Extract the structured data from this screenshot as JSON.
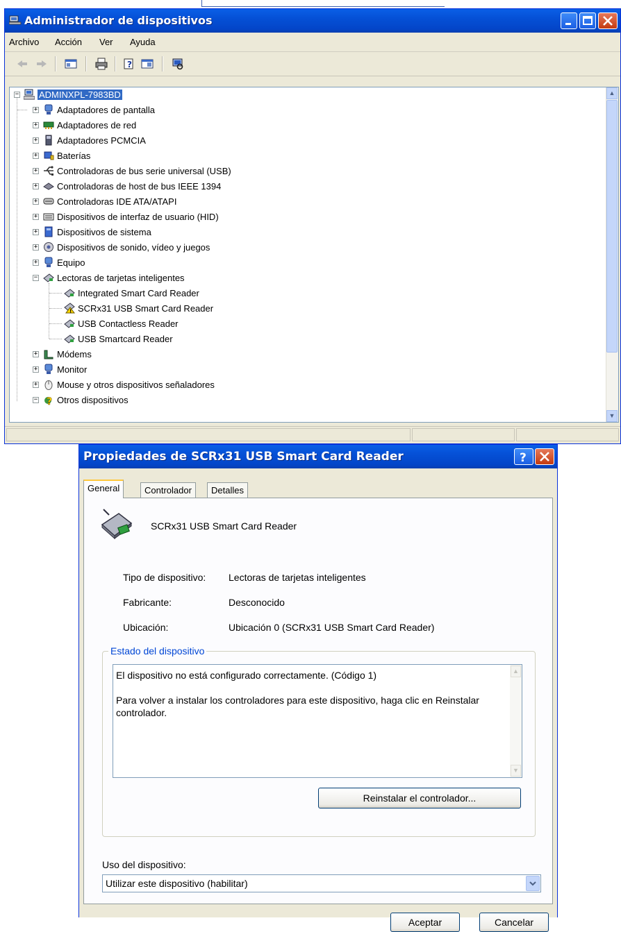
{
  "device_manager": {
    "title": "Administrador de dispositivos",
    "menu": [
      "Archivo",
      "Acción",
      "Ver",
      "Ayuda"
    ],
    "toolbar_icons": [
      "back-arrow-icon",
      "forward-arrow-icon",
      "show-hide-console-tree-icon",
      "print-icon",
      "properties-icon",
      "help-icon",
      "scan-hardware-icon"
    ],
    "tree": {
      "root": "ADMINXPL-7983BD",
      "categories": [
        {
          "label": "Adaptadores de pantalla",
          "icon": "display-adapter-icon",
          "expanded": false
        },
        {
          "label": "Adaptadores de red",
          "icon": "network-adapter-icon",
          "expanded": false
        },
        {
          "label": "Adaptadores PCMCIA",
          "icon": "pcmcia-icon",
          "expanded": false
        },
        {
          "label": "Baterías",
          "icon": "battery-icon",
          "expanded": false
        },
        {
          "label": "Controladoras de bus serie universal (USB)",
          "icon": "usb-icon",
          "expanded": false
        },
        {
          "label": "Controladoras de host de bus IEEE 1394",
          "icon": "ieee1394-icon",
          "expanded": false
        },
        {
          "label": "Controladoras IDE ATA/ATAPI",
          "icon": "ide-controller-icon",
          "expanded": false
        },
        {
          "label": "Dispositivos de interfaz de usuario (HID)",
          "icon": "hid-icon",
          "expanded": false
        },
        {
          "label": "Dispositivos de sistema",
          "icon": "system-device-icon",
          "expanded": false
        },
        {
          "label": "Dispositivos de sonido, vídeo y juegos",
          "icon": "sound-icon",
          "expanded": false
        },
        {
          "label": "Equipo",
          "icon": "computer-icon",
          "expanded": false
        },
        {
          "label": "Lectoras de tarjetas inteligentes",
          "icon": "smart-card-reader-icon",
          "expanded": true
        },
        {
          "label": "Módems",
          "icon": "modem-icon",
          "expanded": false
        },
        {
          "label": "Monitor",
          "icon": "monitor-icon",
          "expanded": false
        },
        {
          "label": "Mouse y otros dispositivos señaladores",
          "icon": "mouse-icon",
          "expanded": false
        },
        {
          "label": "Otros dispositivos",
          "icon": "unknown-device-icon",
          "expanded": true
        }
      ],
      "smart_card_children": [
        {
          "label": "Integrated Smart Card Reader",
          "warning": false
        },
        {
          "label": "SCRx31 USB Smart Card Reader",
          "warning": true
        },
        {
          "label": "USB Contactless Reader",
          "warning": false
        },
        {
          "label": "USB Smartcard Reader",
          "warning": false
        }
      ]
    }
  },
  "properties_dialog": {
    "title": "Propiedades de SCRx31 USB Smart Card Reader",
    "tabs": [
      "General",
      "Controlador",
      "Detalles"
    ],
    "active_tab": "General",
    "device_name": "SCRx31 USB Smart Card Reader",
    "fields": [
      {
        "label": "Tipo de dispositivo:",
        "value": "Lectoras de tarjetas inteligentes"
      },
      {
        "label": "Fabricante:",
        "value": "Desconocido"
      },
      {
        "label": "Ubicación:",
        "value": "Ubicación 0 (SCRx31 USB Smart Card Reader)"
      }
    ],
    "status_group_label": "Estado del dispositivo",
    "status_line1": "El dispositivo no está configurado correctamente. (Código 1)",
    "status_line2": "Para volver a instalar los controladores para este dispositivo, haga clic en Reinstalar controlador.",
    "reinstall_button": "Reinstalar el controlador...",
    "usage_label": "Uso del dispositivo:",
    "usage_value": "Utilizar este dispositivo (habilitar)",
    "ok_button": "Aceptar",
    "cancel_button": "Cancelar"
  },
  "colors": {
    "titlebar": "#0550d6",
    "selection": "#316ac5",
    "group_label": "#0046d5",
    "warning": "#ffd800"
  }
}
